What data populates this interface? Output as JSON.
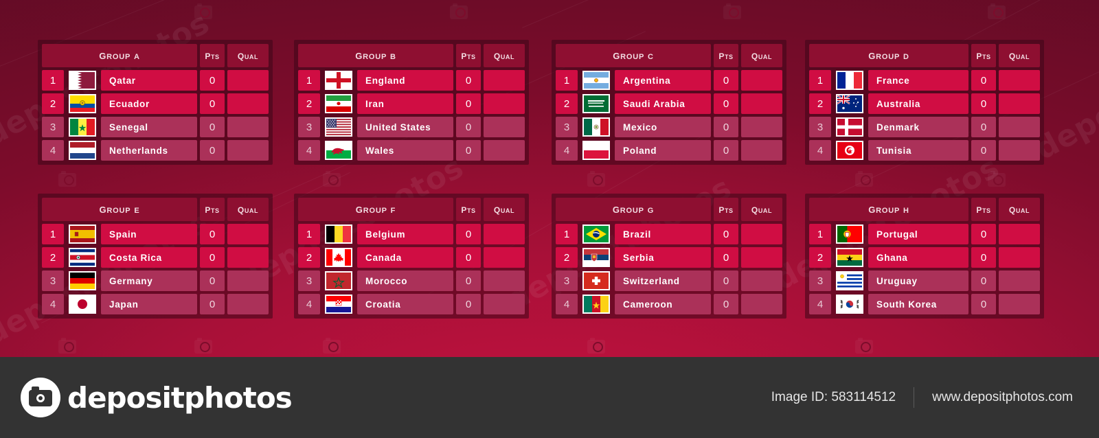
{
  "columns": {
    "pts": "Pts",
    "qual": "Qual"
  },
  "colors": {
    "qualified_row": "#d00d43",
    "eliminated_row": "#ab3159",
    "header_cell": "#8e0f31",
    "panel_bg": "#3c0618",
    "footer_bg": "#333333",
    "background_top": "#5c0b24",
    "background_bottom": "#c4123f"
  },
  "groups": [
    {
      "title": "Group A",
      "teams": [
        {
          "rank": "1",
          "name": "Qatar",
          "pts": "0",
          "qual": "",
          "flag": "qatar"
        },
        {
          "rank": "2",
          "name": "Ecuador",
          "pts": "0",
          "qual": "",
          "flag": "ecuador"
        },
        {
          "rank": "3",
          "name": "Senegal",
          "pts": "0",
          "qual": "",
          "flag": "senegal"
        },
        {
          "rank": "4",
          "name": "Netherlands",
          "pts": "0",
          "qual": "",
          "flag": "netherlands"
        }
      ]
    },
    {
      "title": "Group B",
      "teams": [
        {
          "rank": "1",
          "name": "England",
          "pts": "0",
          "qual": "",
          "flag": "england"
        },
        {
          "rank": "2",
          "name": "Iran",
          "pts": "0",
          "qual": "",
          "flag": "iran"
        },
        {
          "rank": "3",
          "name": "United States",
          "pts": "0",
          "qual": "",
          "flag": "usa"
        },
        {
          "rank": "4",
          "name": "Wales",
          "pts": "0",
          "qual": "",
          "flag": "wales"
        }
      ]
    },
    {
      "title": "Group C",
      "teams": [
        {
          "rank": "1",
          "name": "Argentina",
          "pts": "0",
          "qual": "",
          "flag": "argentina"
        },
        {
          "rank": "2",
          "name": "Saudi Arabia",
          "pts": "0",
          "qual": "",
          "flag": "saudi"
        },
        {
          "rank": "3",
          "name": "Mexico",
          "pts": "0",
          "qual": "",
          "flag": "mexico"
        },
        {
          "rank": "4",
          "name": "Poland",
          "pts": "0",
          "qual": "",
          "flag": "poland"
        }
      ]
    },
    {
      "title": "Group D",
      "teams": [
        {
          "rank": "1",
          "name": "France",
          "pts": "0",
          "qual": "",
          "flag": "france"
        },
        {
          "rank": "2",
          "name": "Australia",
          "pts": "0",
          "qual": "",
          "flag": "australia"
        },
        {
          "rank": "3",
          "name": "Denmark",
          "pts": "0",
          "qual": "",
          "flag": "denmark"
        },
        {
          "rank": "4",
          "name": "Tunisia",
          "pts": "0",
          "qual": "",
          "flag": "tunisia"
        }
      ]
    },
    {
      "title": "Group E",
      "teams": [
        {
          "rank": "1",
          "name": "Spain",
          "pts": "0",
          "qual": "",
          "flag": "spain"
        },
        {
          "rank": "2",
          "name": "Costa Rica",
          "pts": "0",
          "qual": "",
          "flag": "costarica"
        },
        {
          "rank": "3",
          "name": "Germany",
          "pts": "0",
          "qual": "",
          "flag": "germany"
        },
        {
          "rank": "4",
          "name": "Japan",
          "pts": "0",
          "qual": "",
          "flag": "japan"
        }
      ]
    },
    {
      "title": "Group F",
      "teams": [
        {
          "rank": "1",
          "name": "Belgium",
          "pts": "0",
          "qual": "",
          "flag": "belgium"
        },
        {
          "rank": "2",
          "name": "Canada",
          "pts": "0",
          "qual": "",
          "flag": "canada"
        },
        {
          "rank": "3",
          "name": "Morocco",
          "pts": "0",
          "qual": "",
          "flag": "morocco"
        },
        {
          "rank": "4",
          "name": "Croatia",
          "pts": "0",
          "qual": "",
          "flag": "croatia"
        }
      ]
    },
    {
      "title": "Group G",
      "teams": [
        {
          "rank": "1",
          "name": "Brazil",
          "pts": "0",
          "qual": "",
          "flag": "brazil"
        },
        {
          "rank": "2",
          "name": "Serbia",
          "pts": "0",
          "qual": "",
          "flag": "serbia"
        },
        {
          "rank": "3",
          "name": "Switzerland",
          "pts": "0",
          "qual": "",
          "flag": "switzerland"
        },
        {
          "rank": "4",
          "name": "Cameroon",
          "pts": "0",
          "qual": "",
          "flag": "cameroon"
        }
      ]
    },
    {
      "title": "Group H",
      "teams": [
        {
          "rank": "1",
          "name": "Portugal",
          "pts": "0",
          "qual": "",
          "flag": "portugal"
        },
        {
          "rank": "2",
          "name": "Ghana",
          "pts": "0",
          "qual": "",
          "flag": "ghana"
        },
        {
          "rank": "3",
          "name": "Uruguay",
          "pts": "0",
          "qual": "",
          "flag": "uruguay"
        },
        {
          "rank": "4",
          "name": "South Korea",
          "pts": "0",
          "qual": "",
          "flag": "southkorea"
        }
      ]
    }
  ],
  "footer": {
    "brand": "depositphotos",
    "image_id": "Image ID: 583114512",
    "website": "www.depositphotos.com"
  },
  "watermark": {
    "text": "depositphotos"
  }
}
